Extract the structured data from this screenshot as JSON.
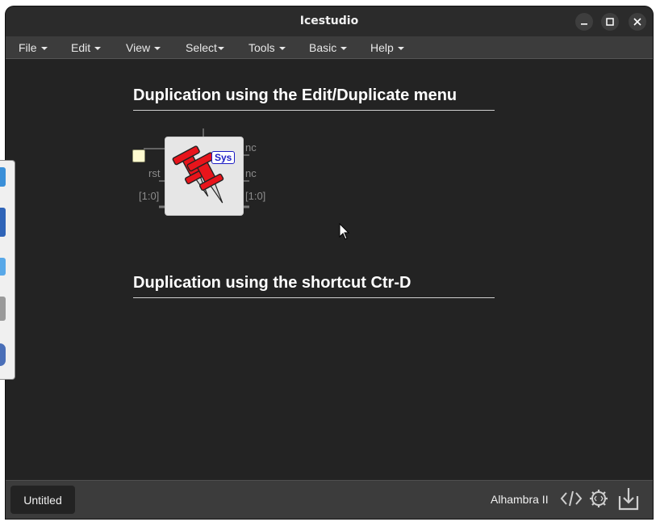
{
  "window": {
    "title": "Icestudio",
    "controls": {
      "minimize": "minimize-icon",
      "maximize": "maximize-icon",
      "close": "close-icon"
    }
  },
  "menu": [
    {
      "label": "File"
    },
    {
      "label": "Edit"
    },
    {
      "label": "View"
    },
    {
      "label": "Select"
    },
    {
      "label": "Tools"
    },
    {
      "label": "Basic"
    },
    {
      "label": "Help"
    }
  ],
  "canvas": {
    "heading1": "Duplication using the Edit/Duplicate menu",
    "heading2": "Duplication using the shortcut Ctr-D",
    "block": {
      "badge": "Sys",
      "input_rst": "rst",
      "input_bus": "[1:0]",
      "output_nc1": "nc",
      "output_nc2": "nc",
      "output_bus": "[1:0]",
      "icon": "pushpin-icon"
    }
  },
  "footer": {
    "tab_label": "Untitled",
    "board": "Alhambra II",
    "icons": [
      "code-icon",
      "gear-code-icon",
      "download-icon"
    ]
  },
  "colors": {
    "canvas_bg": "#232323",
    "menubar_bg": "#3c3c3c",
    "pin_red": "#e8141b",
    "badge_text": "#1d1dc4",
    "input_port": "#fffbd0"
  }
}
